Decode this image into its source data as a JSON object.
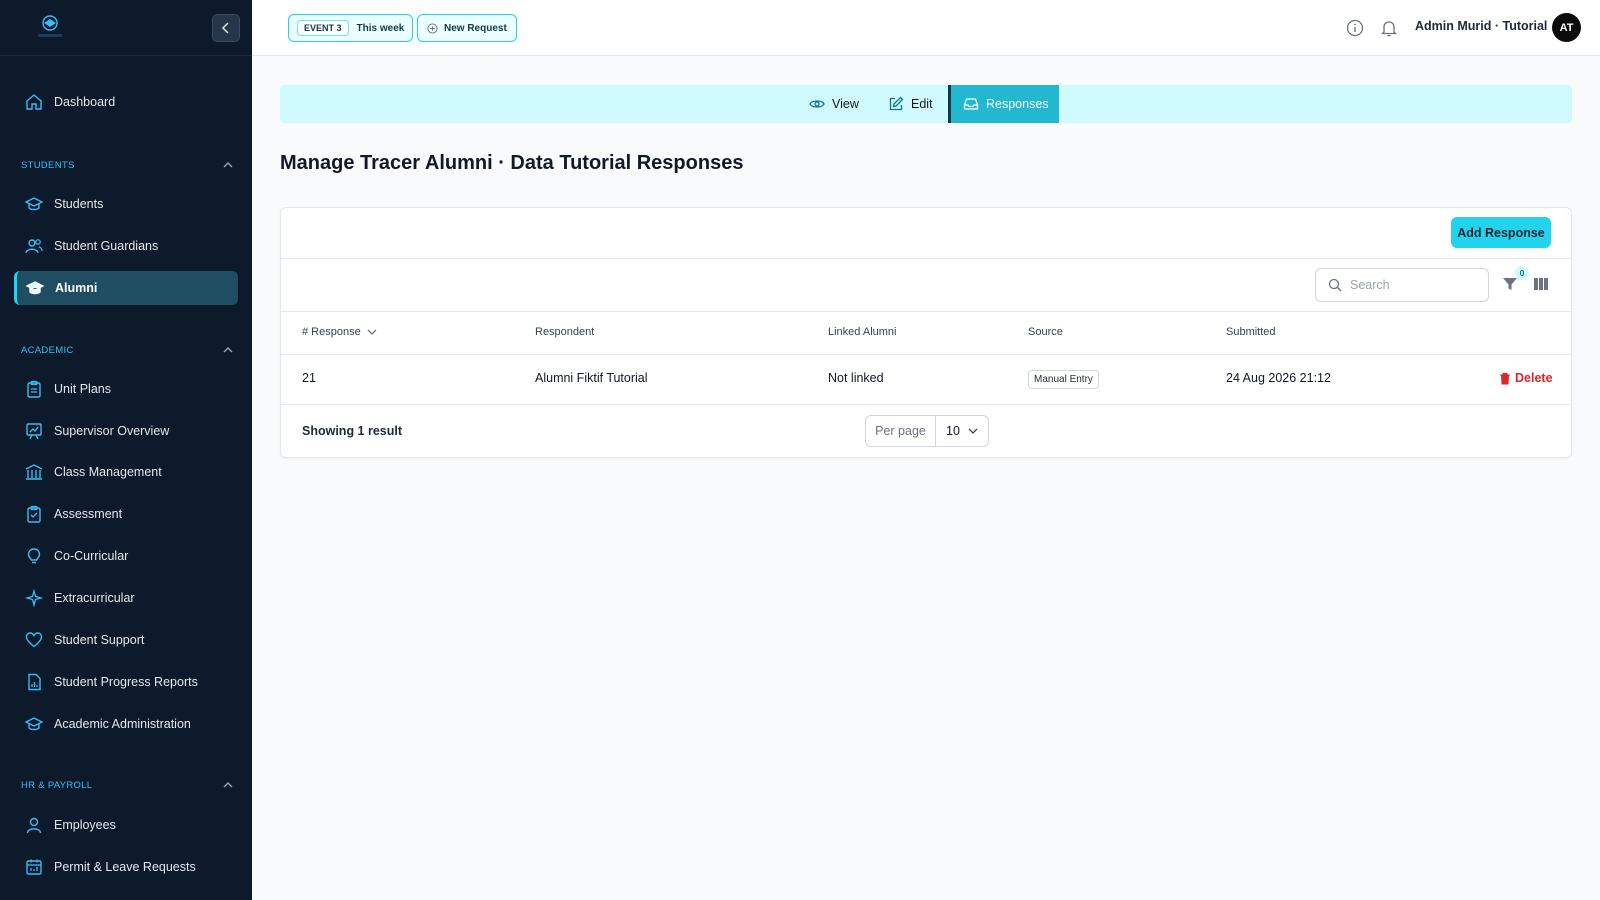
{
  "sidebar": {
    "logo_text": "DEMO",
    "dashboard": "Dashboard",
    "sections": {
      "students": "STUDENTS",
      "academic": "ACADEMIC",
      "hr": "HR & PAYROLL"
    },
    "items": {
      "students": "Students",
      "guardians": "Student Guardians",
      "alumni": "Alumni",
      "unit_plans": "Unit Plans",
      "supervisor": "Supervisor Overview",
      "class_mgmt": "Class Management",
      "assessment": "Assessment",
      "co_curricular": "Co-Curricular",
      "extracurricular": "Extracurricular",
      "student_support": "Student Support",
      "progress_reports": "Student Progress Reports",
      "academic_admin": "Academic Administration",
      "employees": "Employees",
      "permit_leave": "Permit & Leave Requests"
    }
  },
  "topbar": {
    "event_label": "EVENT 3",
    "event_period": "This week",
    "new_request": "New Request",
    "user_name": "Admin Murid · Tutorial",
    "avatar_initials": "AT"
  },
  "tabs": {
    "view": "View",
    "edit": "Edit",
    "responses": "Responses"
  },
  "page": {
    "title": "Manage Tracer Alumni · Data Tutorial Responses"
  },
  "table": {
    "add_button": "Add Response",
    "search_placeholder": "Search",
    "filter_count": "0",
    "columns": {
      "response": "# Response",
      "respondent": "Respondent",
      "linked": "Linked Alumni",
      "source": "Source",
      "submitted": "Submitted"
    },
    "rows": [
      {
        "response": "21",
        "respondent": "Alumni Fiktif Tutorial",
        "linked": "Not linked",
        "source": "Manual Entry",
        "submitted": "24 Aug 2026 21:12",
        "action": "Delete"
      }
    ],
    "showing": "Showing 1 result",
    "per_page_label": "Per page",
    "per_page_value": "10"
  },
  "colors": {
    "sidebar_bg": "#0c1a2b",
    "accent": "#22d3ee",
    "danger": "#dc2626"
  }
}
